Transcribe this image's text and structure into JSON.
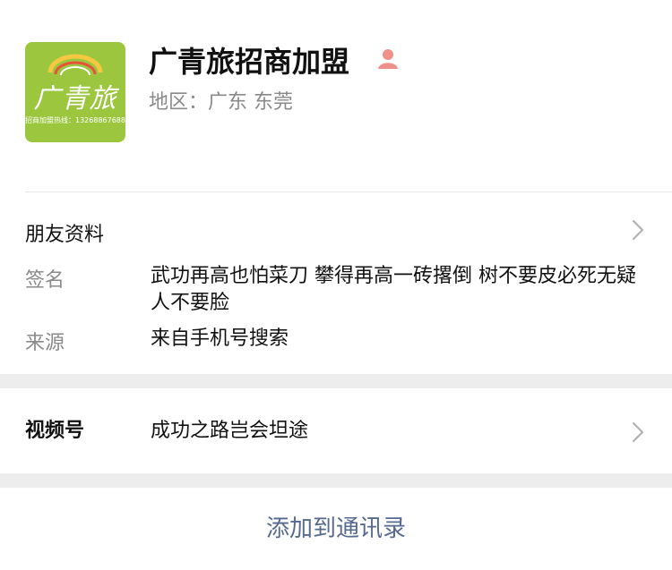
{
  "profile": {
    "name": "广青旅招商加盟",
    "region": "地区：广东 东莞",
    "avatar": {
      "logo_text": "广青旅",
      "logo_subtext": "招商加盟热线：13268867688"
    }
  },
  "friend_info": {
    "title": "朋友资料",
    "signature_label": "签名",
    "signature_value": "武功再高也怕菜刀 攀得再高一砖撂倒 树不要皮必死无疑 人不要脸",
    "source_label": "来源",
    "source_value": "来自手机号搜索"
  },
  "channels": {
    "label": "视频号",
    "value": "成功之路岂会坦途"
  },
  "actions": {
    "add_contact": "添加到通讯录"
  },
  "colors": {
    "link": "#57698f",
    "muted": "#8a8a8a",
    "band": "#ededed",
    "avatar_bg": "#9bc63d",
    "person_icon": "#f0908a"
  },
  "icons": [
    "person-icon",
    "chevron-right-icon"
  ]
}
